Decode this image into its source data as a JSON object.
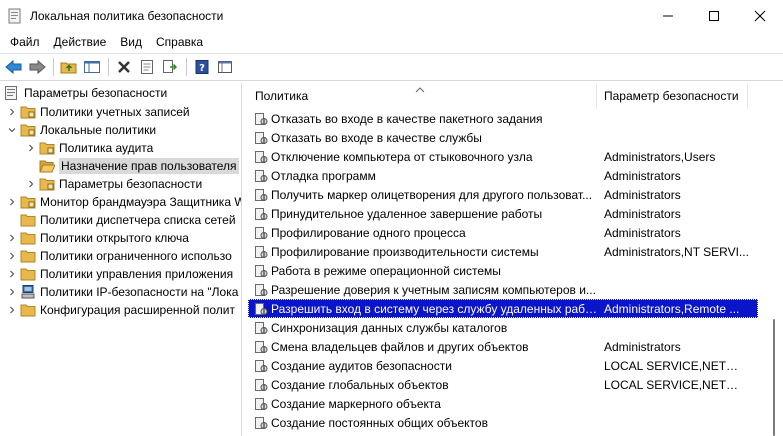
{
  "window": {
    "title": "Локальная политика безопасности",
    "minimize_glyph": "—",
    "maximize_glyph": "☐",
    "close_glyph": "✕"
  },
  "menu": [
    "Файл",
    "Действие",
    "Вид",
    "Справка"
  ],
  "toolbar": {
    "icons": [
      "back-arrow-icon",
      "forward-arrow-icon",
      "up-folder-icon",
      "show-tree-icon",
      "delete-icon",
      "properties-icon",
      "export-icon",
      "help-icon",
      "console-icon"
    ]
  },
  "tree": {
    "items": [
      {
        "label": "Параметры безопасности",
        "level": 0,
        "expander": "none",
        "icon": "computer-policy-icon"
      },
      {
        "label": "Политики учетных записей",
        "level": 1,
        "expander": "collapsed",
        "icon": "folder-icon"
      },
      {
        "label": "Локальные политики",
        "level": 1,
        "expander": "expanded",
        "icon": "folder-icon"
      },
      {
        "label": "Политика аудита",
        "level": 2,
        "expander": "collapsed",
        "icon": "folder-icon"
      },
      {
        "label": "Назначение прав пользователя",
        "level": 2,
        "expander": "none",
        "icon": "open-folder-icon",
        "selected": true
      },
      {
        "label": "Параметры безопасности",
        "level": 2,
        "expander": "collapsed",
        "icon": "folder-icon"
      },
      {
        "label": "Монитор брандмауэра Защитника W",
        "level": 1,
        "expander": "collapsed",
        "icon": "folder-icon"
      },
      {
        "label": "Политики диспетчера списка сетей",
        "level": 1,
        "expander": "none",
        "icon": "folder-icon"
      },
      {
        "label": "Политики открытого ключа",
        "level": 1,
        "expander": "collapsed",
        "icon": "folder-icon"
      },
      {
        "label": "Политики ограниченного использо",
        "level": 1,
        "expander": "collapsed",
        "icon": "folder-icon"
      },
      {
        "label": "Политики управления приложения",
        "level": 1,
        "expander": "collapsed",
        "icon": "folder-icon"
      },
      {
        "label": "Политики IP-безопасности на \"Лока",
        "level": 1,
        "expander": "collapsed",
        "icon": "ipsec-icon"
      },
      {
        "label": "Конфигурация расширенной полит",
        "level": 1,
        "expander": "collapsed",
        "icon": "folder-icon"
      }
    ]
  },
  "list": {
    "columns": {
      "policy": "Политика",
      "param": "Параметр безопасности"
    },
    "rows": [
      {
        "policy": "Отказать во входе в качестве пакетного задания",
        "param": ""
      },
      {
        "policy": "Отказать во входе в качестве службы",
        "param": ""
      },
      {
        "policy": "Отключение компьютера от стыковочного узла",
        "param": "Administrators,Users"
      },
      {
        "policy": "Отладка программ",
        "param": "Administrators"
      },
      {
        "policy": "Получить маркер олицетворения для другого пользоват...",
        "param": "Administrators"
      },
      {
        "policy": "Принудительное удаленное завершение работы",
        "param": "Administrators"
      },
      {
        "policy": "Профилирование одного процесса",
        "param": "Administrators"
      },
      {
        "policy": "Профилирование производительности системы",
        "param": "Administrators,NT SERVI..."
      },
      {
        "policy": "Работа в режиме операционной системы",
        "param": ""
      },
      {
        "policy": "Разрешение доверия к учетным записям компьютеров и...",
        "param": ""
      },
      {
        "policy": "Разрешить вход в систему через службу удаленных рабо...",
        "param": "Administrators,Remote ...",
        "selected": true
      },
      {
        "policy": "Синхронизация данных службы каталогов",
        "param": ""
      },
      {
        "policy": "Смена владельцев файлов и других объектов",
        "param": "Administrators"
      },
      {
        "policy": "Создание аудитов безопасности",
        "param": "LOCAL SERVICE,NETWO..."
      },
      {
        "policy": "Создание глобальных объектов",
        "param": "LOCAL SERVICE,NETWO..."
      },
      {
        "policy": "Создание маркерного объекта",
        "param": ""
      },
      {
        "policy": "Создание постоянных общих объектов",
        "param": ""
      }
    ]
  },
  "colors": {
    "selection": "#0a14c8",
    "tree_selection": "#d9d9d9",
    "folder": "#e8b84a"
  }
}
